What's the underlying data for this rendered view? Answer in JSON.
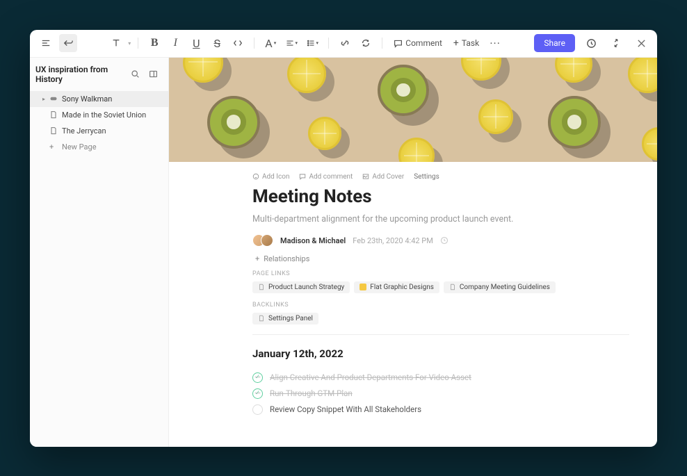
{
  "toolbar": {
    "comment": "Comment",
    "task": "Task",
    "share": "Share"
  },
  "sidebar": {
    "title": "UX inspiration from History",
    "items": [
      {
        "label": "Sony Walkman",
        "icon": "gamepad",
        "selected": true,
        "children": [
          {
            "label": "Made in the Soviet Union"
          },
          {
            "label": "The Jerrycan"
          }
        ]
      }
    ],
    "newPage": "New Page"
  },
  "cover": {
    "alt": "Sliced kiwi and lemon pattern on tan background"
  },
  "actions": {
    "addIcon": "Add Icon",
    "addComment": "Add comment",
    "addCover": "Add Cover",
    "settings": "Settings"
  },
  "doc": {
    "title": "Meeting Notes",
    "subtitle": "Multi-department alignment for the upcoming product launch event.",
    "authors": "Madison & Michael",
    "date": "Feb 23th, 2020  4:42 PM",
    "relationships": "Relationships"
  },
  "pageLinks": {
    "label": "PAGE LINKS",
    "items": [
      "Product Launch Strategy",
      "Flat Graphic Designs",
      "Company Meeting Guidelines"
    ]
  },
  "backlinks": {
    "label": "BACKLINKS",
    "items": [
      "Settings Panel"
    ]
  },
  "notes": {
    "dateHeading": "January 12th, 2022",
    "tasks": [
      {
        "text": "Align Creative And Product Departments For Video Asset",
        "state": "done"
      },
      {
        "text": "Run-Through GTM Plan",
        "state": "done"
      },
      {
        "text": "Review Copy Snippet With All Stakeholders",
        "state": "empty"
      }
    ]
  }
}
